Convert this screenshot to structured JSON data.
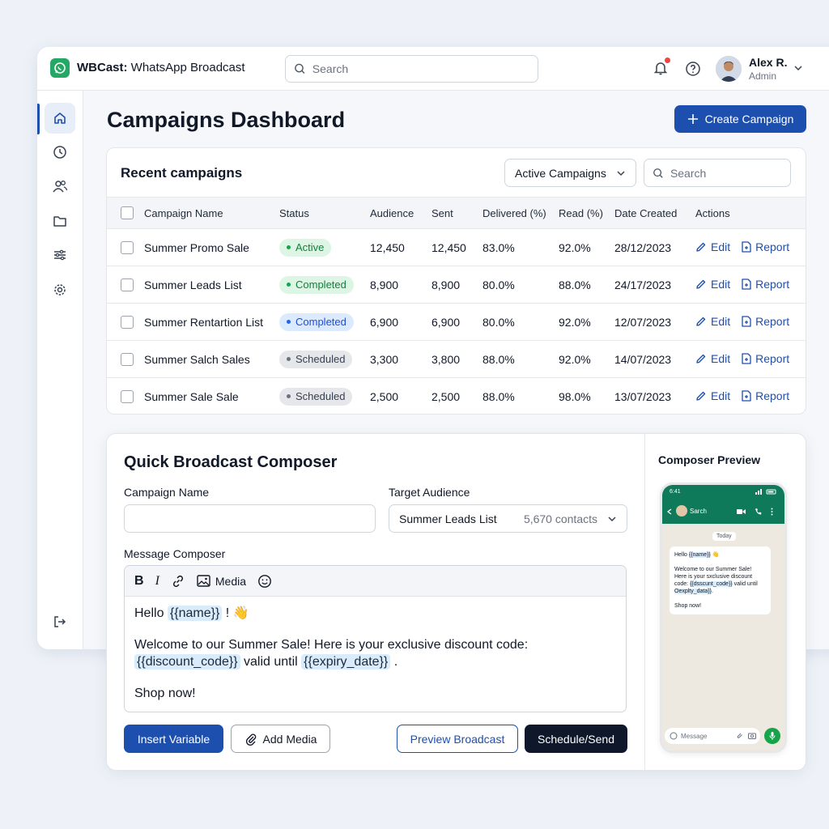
{
  "header": {
    "brand_bold": "WBCast:",
    "brand_rest": " WhatsApp Broadcast",
    "search_placeholder": "Search",
    "user_name": "Alex R.",
    "user_role": "Admin"
  },
  "sidebar": {
    "items": [
      {
        "icon": "home-icon",
        "active": true
      },
      {
        "icon": "clock-icon",
        "active": false
      },
      {
        "icon": "users-icon",
        "active": false
      },
      {
        "icon": "folder-icon",
        "active": false
      },
      {
        "icon": "sliders-icon",
        "active": false
      },
      {
        "icon": "gear-icon",
        "active": false
      }
    ],
    "bottom_icon": "logout-icon"
  },
  "page": {
    "title": "Campaigns Dashboard",
    "create_label": "Create Campaign"
  },
  "campaigns": {
    "title": "Recent campaigns",
    "filter_label": "Active Campaigns",
    "search_placeholder": "Search",
    "columns": [
      "Campaign Name",
      "Status",
      "Audience",
      "Sent",
      "Delivered (%)",
      "Read (%)",
      "Date Created",
      "Actions"
    ],
    "edit_label": "Edit",
    "report_label": "Report",
    "rows": [
      {
        "name": "Summer Promo Sale",
        "status": "Active",
        "status_style": "active",
        "audience": "12,450",
        "sent": "12,450",
        "delivered": "83.0%",
        "read": "92.0%",
        "date": "28/12/2023"
      },
      {
        "name": "Summer Leads List",
        "status": "Completed",
        "status_style": "completed",
        "audience": "8,900",
        "sent": "8,900",
        "delivered": "80.0%",
        "read": "88.0%",
        "date": "24/17/2023"
      },
      {
        "name": "Summer Rentartion List",
        "status": "Completed",
        "status_style": "completed-blue",
        "audience": "6,900",
        "sent": "6,900",
        "delivered": "80.0%",
        "read": "92.0%",
        "date": "12/07/2023"
      },
      {
        "name": "Summer Salch Sales",
        "status": "Scheduled",
        "status_style": "scheduled",
        "audience": "3,300",
        "sent": "3,800",
        "delivered": "88.0%",
        "read": "92.0%",
        "date": "14/07/2023"
      },
      {
        "name": "Summer Sale Sale",
        "status": "Scheduled",
        "status_style": "scheduled",
        "audience": "2,500",
        "sent": "2,500",
        "delivered": "88.0%",
        "read": "98.0%",
        "date": "13/07/2023"
      }
    ]
  },
  "composer": {
    "title": "Quick Broadcast Composer",
    "campaign_name_label": "Campaign Name",
    "campaign_name_value": "",
    "target_label": "Target Audience",
    "target_value": "Summer Leads List",
    "target_count": "5,670 contacts",
    "message_label": "Message Composer",
    "toolbar": {
      "bold": "B",
      "italic": "I",
      "media": "Media"
    },
    "message": {
      "hello": "Hello ",
      "name_var": "{{name}}",
      "after_name": " ! 👋",
      "welcome": "Welcome to our Summer Sale! Here is your exclusive discount code:",
      "code_var": "{{discount_code}}",
      "valid_until": " valid until ",
      "expiry_var": "{{expiry_date}}",
      "period": " .",
      "shop": "Shop now!"
    },
    "buttons": {
      "insert_variable": "Insert Variable",
      "add_media": "Add Media",
      "preview": "Preview Broadcast",
      "send": "Schedule/Send"
    }
  },
  "preview": {
    "title": "Composer Preview",
    "phone_time": "6:41",
    "contact": "Sarch",
    "today": "Today",
    "bubble": {
      "line1a": "Hello ",
      "line1v": "{{name}}",
      "line1b": " 👋",
      "line2": "Welcome to our Summer Sale!",
      "line3": "Here is your sxclusive discount",
      "line4a": "code: ",
      "line4v": "{{dsscunt_code}}",
      "line4b": " valid until",
      "line5v": "Oexplty_data}}",
      "line5b": ".",
      "line6": "Shop now!"
    },
    "input_placeholder": "Message"
  },
  "colors": {
    "accent": "#1d4fae",
    "brand_green": "#25a866",
    "whatsapp_header": "#0f7a5a",
    "dark_button": "#0f172a"
  }
}
